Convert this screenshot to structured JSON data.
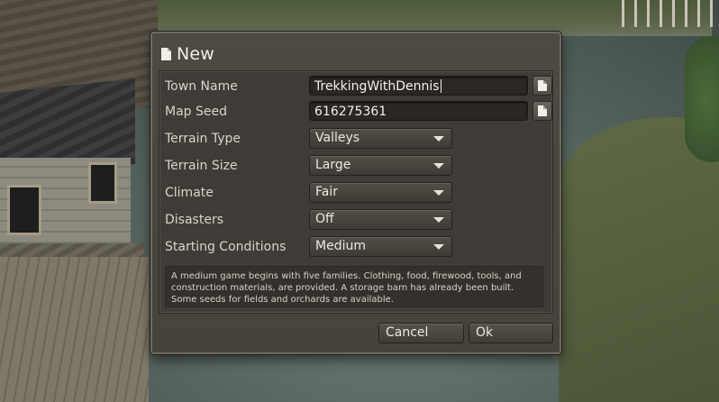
{
  "dialog": {
    "title": "New",
    "title_icon": "document-icon"
  },
  "form": {
    "town_name": {
      "label": "Town Name",
      "value": "TrekkingWithDennis",
      "button_icon": "document-icon"
    },
    "map_seed": {
      "label": "Map Seed",
      "value": "616275361",
      "button_icon": "document-icon"
    },
    "terrain_type": {
      "label": "Terrain Type",
      "value": "Valleys"
    },
    "terrain_size": {
      "label": "Terrain Size",
      "value": "Large"
    },
    "climate": {
      "label": "Climate",
      "value": "Fair"
    },
    "disasters": {
      "label": "Disasters",
      "value": "Off"
    },
    "starting_conditions": {
      "label": "Starting Conditions",
      "value": "Medium"
    }
  },
  "description": "A medium game begins with five families. Clothing, food, firewood, tools, and construction materials, are provided. A storage barn has already been built. Some seeds for fields and orchards are available.",
  "buttons": {
    "cancel": "Cancel",
    "ok": "Ok"
  },
  "colors": {
    "dialog_bg": "#4a463f",
    "panel_bg": "#3f3b36",
    "text": "#d9d5cc"
  }
}
